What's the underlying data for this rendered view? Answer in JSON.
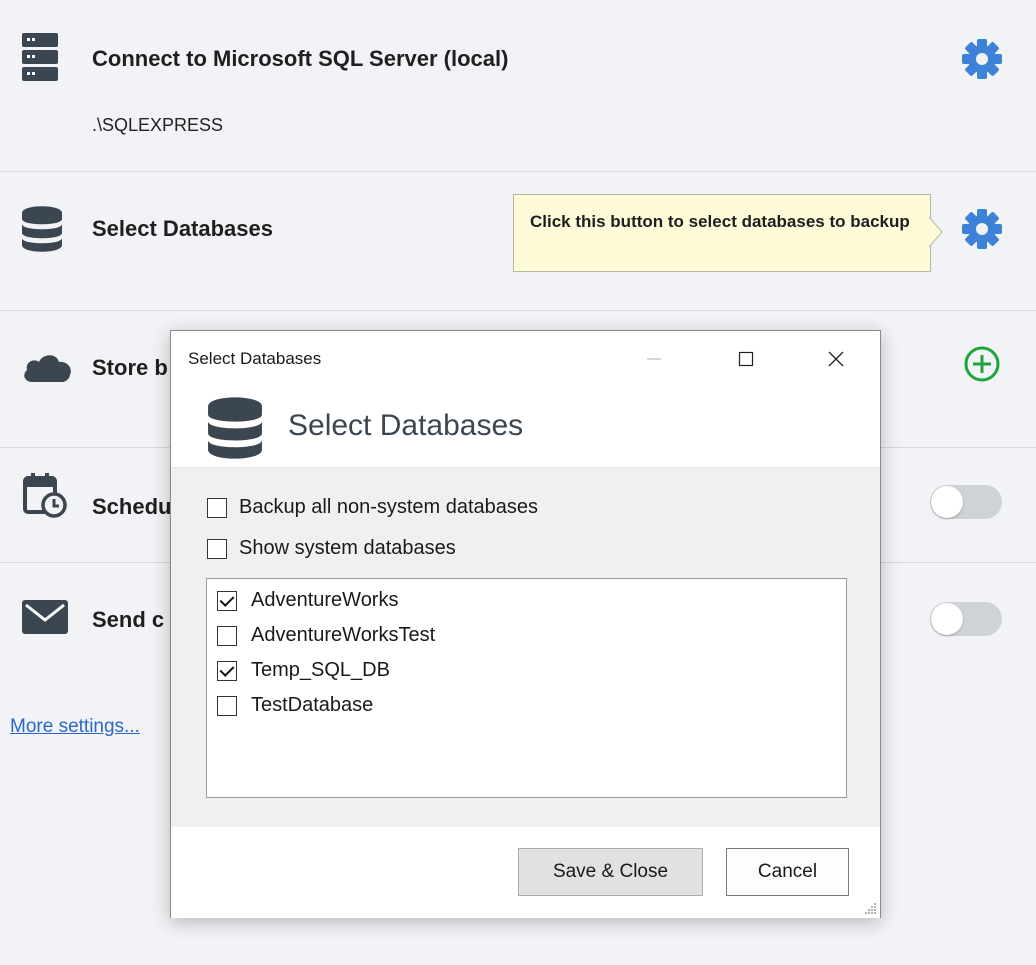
{
  "sections": {
    "connect": {
      "title": "Connect to Microsoft SQL Server (local)",
      "subtitle": ".\\SQLEXPRESS",
      "icon": "server-icon"
    },
    "select": {
      "title": "Select Databases",
      "icon": "database-icon"
    },
    "store": {
      "title": "Store b",
      "icon": "cloud-icon"
    },
    "schedule": {
      "title": "Schedu",
      "icon": "calendar-clock-icon"
    },
    "send": {
      "title": "Send c",
      "icon": "envelope-icon"
    }
  },
  "tooltip": {
    "text": "Click this button to select databases to backup"
  },
  "more_settings": "More settings...",
  "dialog": {
    "title": "Select Databases",
    "heading": "Select Databases",
    "options": [
      {
        "label": "Backup all non-system databases",
        "checked": false
      },
      {
        "label": "Show system databases",
        "checked": false
      }
    ],
    "databases": [
      {
        "label": "AdventureWorks",
        "checked": true
      },
      {
        "label": "AdventureWorksTest",
        "checked": false
      },
      {
        "label": "Temp_SQL_DB",
        "checked": true
      },
      {
        "label": "TestDatabase",
        "checked": false
      }
    ],
    "save_label": "Save & Close",
    "cancel_label": "Cancel"
  },
  "colors": {
    "accent": "#3d82d6",
    "add": "#1fa33b",
    "icon_dark": "#3c4650",
    "tooltip_bg": "#fefcd8"
  }
}
